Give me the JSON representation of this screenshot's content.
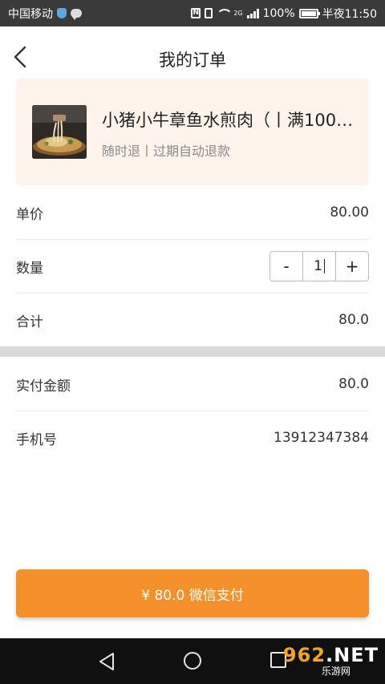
{
  "status_bar": {
    "carrier": "中国移动",
    "network_label": "2G",
    "battery_text": "100%",
    "time": "半夜11:50",
    "icons": [
      "shield-icon",
      "message-icon",
      "nfc-icon",
      "vibrate-icon",
      "wifi-icon",
      "signal-icon",
      "battery-icon"
    ]
  },
  "header": {
    "back_icon": "chevron-left-icon",
    "title": "我的订单"
  },
  "product": {
    "name": "小猪小牛章鱼水煎肉（丨满100…",
    "subtitle": "随时退丨过期自动退款",
    "image": "food-thumbnail"
  },
  "order": {
    "unit_price_label": "单价",
    "unit_price_value": "80.00",
    "quantity_label": "数量",
    "quantity": {
      "minus": "-",
      "value": "1",
      "plus": "+"
    },
    "total_label": "合计",
    "total_value": "80.0",
    "paid_label": "实付金额",
    "paid_value": "80.0",
    "phone_label": "手机号",
    "phone_value": "13912347384"
  },
  "pay_button": {
    "label": "¥ 80.0 微信支付",
    "color": "#f5912b"
  },
  "nav_bar": {
    "icons": [
      "nav-back-icon",
      "nav-home-icon",
      "nav-recent-icon"
    ]
  },
  "watermark": {
    "brand": "962.NET",
    "sub": "乐游网"
  },
  "colors": {
    "accent": "#f5912b",
    "card_bg": "#fef4ec",
    "status_bar_bg": "#3a3a3a"
  }
}
